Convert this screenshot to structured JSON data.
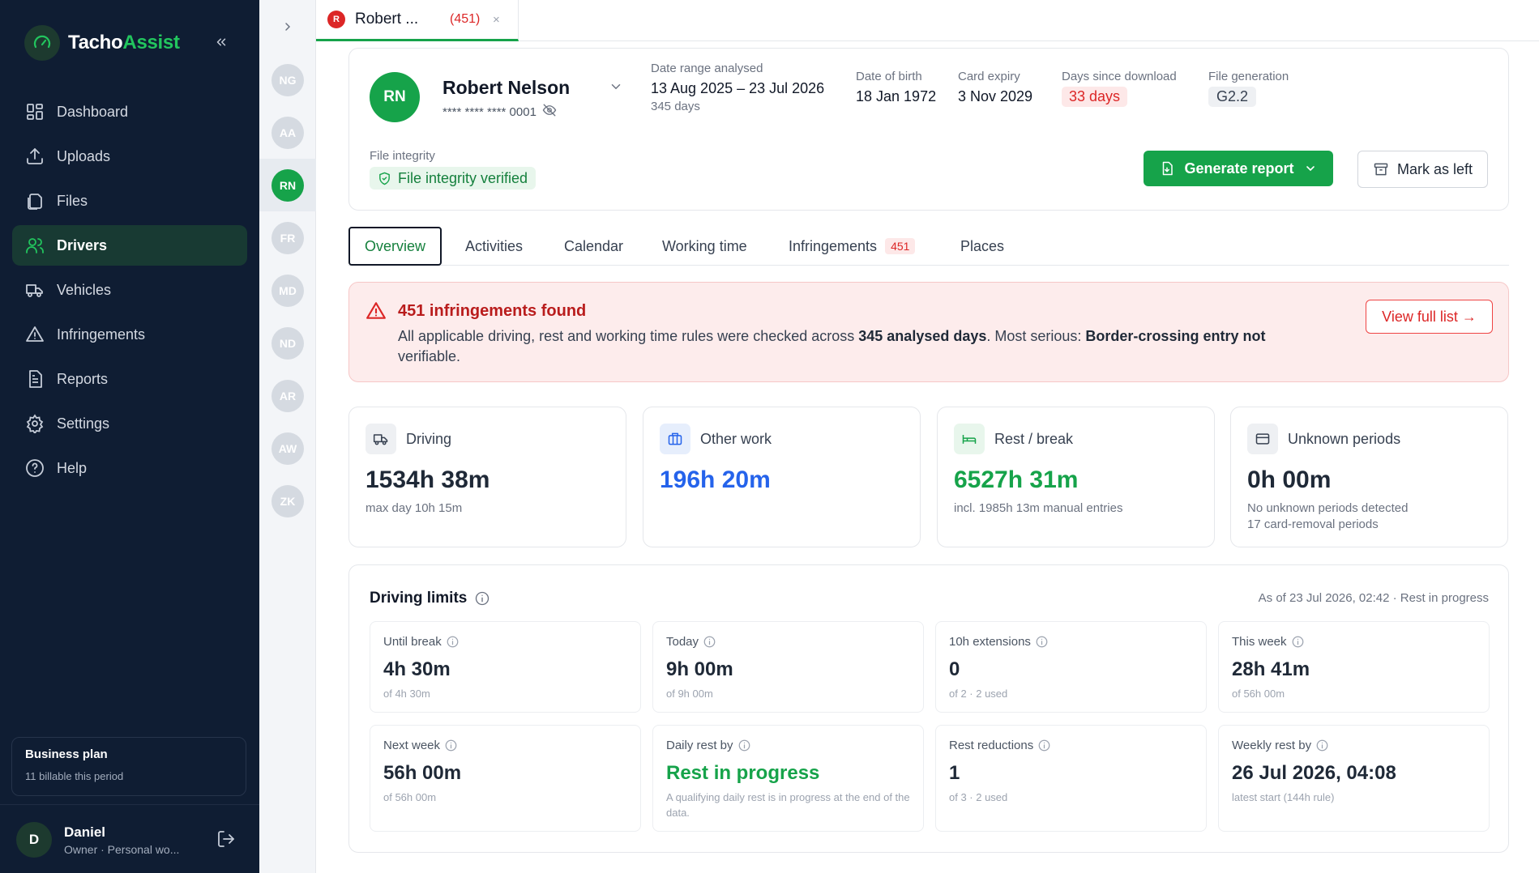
{
  "brand": {
    "name_part1": "Tacho",
    "name_part2": "Assist"
  },
  "nav": {
    "items": [
      {
        "label": "Dashboard",
        "icon": "dashboard-icon"
      },
      {
        "label": "Uploads",
        "icon": "upload-icon"
      },
      {
        "label": "Files",
        "icon": "files-icon"
      },
      {
        "label": "Drivers",
        "icon": "users-icon",
        "active": true
      },
      {
        "label": "Vehicles",
        "icon": "truck-icon"
      },
      {
        "label": "Infringements",
        "icon": "warning-icon"
      },
      {
        "label": "Reports",
        "icon": "report-icon"
      },
      {
        "label": "Settings",
        "icon": "gear-icon"
      },
      {
        "label": "Help",
        "icon": "help-icon"
      }
    ]
  },
  "plan": {
    "title": "Business plan",
    "subtitle": "11 billable this period"
  },
  "user": {
    "initial": "D",
    "name": "Daniel",
    "role": "Owner · Personal wo..."
  },
  "rail": {
    "drivers": [
      "NG",
      "AA",
      "RN",
      "FR",
      "MD",
      "ND",
      "AR",
      "AW",
      "ZK"
    ],
    "active": "RN"
  },
  "open_tab": {
    "initial": "R",
    "title": "Robert ...",
    "count": "(451)",
    "close": "×"
  },
  "driver": {
    "initials": "RN",
    "name": "Robert Nelson",
    "card_number": "**** **** **** 0001",
    "date_range_label": "Date range analysed",
    "date_range": "13 Aug 2025 – 23 Jul 2026",
    "days_analysed": "345 days",
    "dob_label": "Date of birth",
    "dob": "18 Jan 1972",
    "card_expiry_label": "Card expiry",
    "card_expiry": "3 Nov 2029",
    "days_since_label": "Days since download",
    "days_since": "33 days",
    "file_gen_label": "File generation",
    "file_gen": "G2.2",
    "integrity_label": "File integrity",
    "integrity_status": "File integrity verified"
  },
  "actions": {
    "generate": "Generate report",
    "mark_left": "Mark as left"
  },
  "tabs": [
    {
      "label": "Overview",
      "active": true
    },
    {
      "label": "Activities"
    },
    {
      "label": "Calendar"
    },
    {
      "label": "Working time"
    },
    {
      "label": "Infringements",
      "badge": "451"
    },
    {
      "label": "Places"
    }
  ],
  "alert": {
    "title": "451 infringements found",
    "text_1": "All applicable driving, rest and working time rules were checked across ",
    "text_bold_1": "345 analysed days",
    "text_2": ". Most serious: ",
    "text_bold_2": "Border-crossing entry not",
    "text_3": "verifiable.",
    "button": "View full list →"
  },
  "stats": [
    {
      "label": "Driving",
      "value": "1534h 38m",
      "sub": "max day 10h 15m",
      "sub2": "",
      "color": "#1f2937",
      "icon": "truck-icon"
    },
    {
      "label": "Other work",
      "value": "196h 20m",
      "sub": "",
      "sub2": "",
      "color": "#2563eb",
      "icon": "briefcase-icon"
    },
    {
      "label": "Rest / break",
      "value": "6527h 31m",
      "sub": "incl. 1985h 13m manual entries",
      "sub2": "",
      "color": "#16a34a",
      "icon": "bed-icon"
    },
    {
      "label": "Unknown periods",
      "value": "0h 00m",
      "sub": "No unknown periods detected",
      "sub2": "17 card-removal periods",
      "color": "#1f2937",
      "icon": "card-icon"
    }
  ],
  "limits": {
    "title": "Driving limits",
    "as_of": "As of 23 Jul 2026, 02:42 · Rest in progress",
    "items": [
      {
        "label": "Until break",
        "value": "4h 30m",
        "sub": "of 4h 30m"
      },
      {
        "label": "Today",
        "value": "9h 00m",
        "sub": "of 9h 00m"
      },
      {
        "label": "10h extensions",
        "value": "0",
        "sub": "of 2 · 2 used"
      },
      {
        "label": "This week",
        "value": "28h 41m",
        "sub": "of 56h 00m"
      },
      {
        "label": "Next week",
        "value": "56h 00m",
        "sub": "of 56h 00m"
      },
      {
        "label": "Daily rest by",
        "value": "Rest in progress",
        "sub": "A qualifying daily rest is in progress at the end of the data.",
        "color": "#16a34a"
      },
      {
        "label": "Rest reductions",
        "value": "1",
        "sub": "of 3 · 2 used"
      },
      {
        "label": "Weekly rest by",
        "value": "26 Jul 2026, 04:08",
        "sub": "latest start (144h rule)"
      }
    ]
  }
}
